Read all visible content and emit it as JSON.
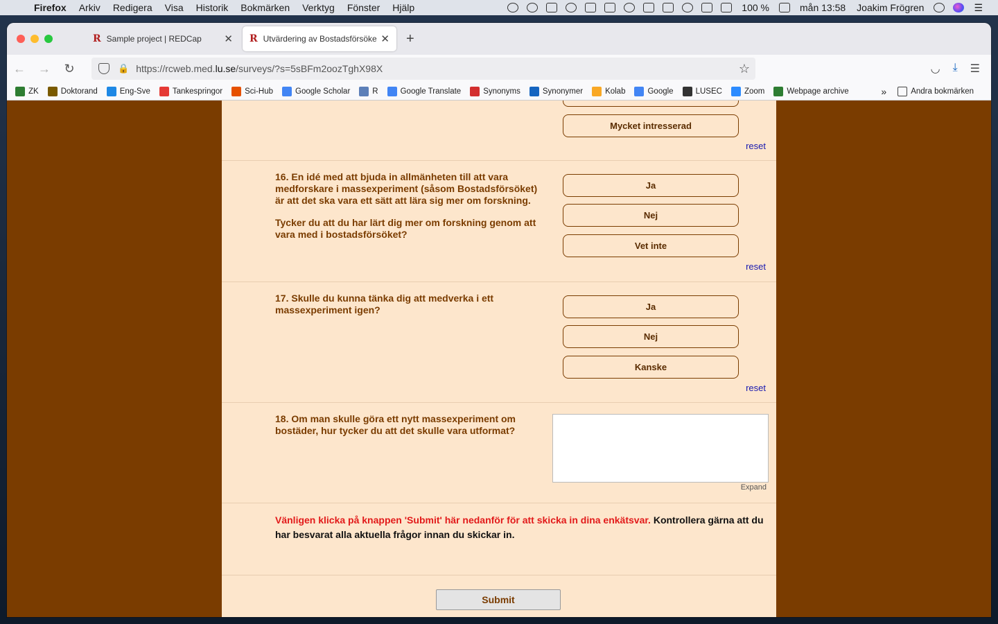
{
  "menubar": {
    "app": "Firefox",
    "items": [
      "Arkiv",
      "Redigera",
      "Visa",
      "Historik",
      "Bokmärken",
      "Verktyg",
      "Fönster",
      "Hjälp"
    ],
    "battery": "100 %",
    "datetime": "mån 13:58",
    "user": "Joakim Frögren"
  },
  "tabs": [
    {
      "title": "Sample project | REDCap"
    },
    {
      "title": "Utvärdering av Bostadsförsöket"
    }
  ],
  "urlbar": {
    "prefix": "https://rcweb.med.",
    "domain": "lu.se",
    "suffix": "/surveys/?s=5sBFm2oozTghX98X"
  },
  "bookmarks": [
    {
      "label": "ZK",
      "icon": "zk-icon",
      "color": "#2e7d32"
    },
    {
      "label": "Doktorand",
      "icon": "lu-icon",
      "color": "#7a5a00"
    },
    {
      "label": "Eng-Sve",
      "icon": "speech-bubble-icon",
      "color": "#1e88e5"
    },
    {
      "label": "Tankespringor",
      "icon": "lightning-icon",
      "color": "#e53935"
    },
    {
      "label": "Sci-Hub",
      "icon": "crow-icon",
      "color": "#e65100"
    },
    {
      "label": "Google Scholar",
      "icon": "scholar-icon",
      "color": "#4285f4"
    },
    {
      "label": "R",
      "icon": "r-icon",
      "color": "#5c7fb8"
    },
    {
      "label": "Google Translate",
      "icon": "translate-icon",
      "color": "#4285f4"
    },
    {
      "label": "Synonyms",
      "icon": "synonyms-icon",
      "color": "#d32f2f"
    },
    {
      "label": "Synonymer",
      "icon": "syn-icon",
      "color": "#1565c0"
    },
    {
      "label": "Kolab",
      "icon": "kolab-icon",
      "color": "#f9a825"
    },
    {
      "label": "Google",
      "icon": "google-icon",
      "color": "#4285f4"
    },
    {
      "label": "LUSEC",
      "icon": "lusec-icon",
      "color": "#333333"
    },
    {
      "label": "Zoom",
      "icon": "zoom-icon",
      "color": "#2d8cff"
    },
    {
      "label": "Webpage archive",
      "icon": "archive-icon",
      "color": "#2e7d32"
    }
  ],
  "bookmarks_other": "Andra bokmärken",
  "survey": {
    "q15": {
      "choices": [
        "Mycket intresserad"
      ],
      "reset": "reset"
    },
    "q16": {
      "text1": "16. En idé med att bjuda in allmänheten till att vara medforskare i massexperiment (såsom Bostadsförsöket) är att det ska vara ett sätt att lära sig mer om forskning.",
      "text2": "Tycker du att du har lärt dig mer om forskning genom att vara med i bostadsförsöket?",
      "choices": [
        "Ja",
        "Nej",
        "Vet inte"
      ],
      "reset": "reset"
    },
    "q17": {
      "text": "17. Skulle du kunna tänka dig att medverka i ett massexperiment igen?",
      "choices": [
        "Ja",
        "Nej",
        "Kanske"
      ],
      "reset": "reset"
    },
    "q18": {
      "text": "18. Om man skulle göra ett nytt massexperiment om bostäder, hur tycker du att det skulle vara utformat?",
      "value": "",
      "expand": "Expand"
    },
    "notice_red": "Vänligen klicka på knappen 'Submit' här nedanför för att skicka in dina enkätsvar.",
    "notice_black": " Kontrollera gärna att du har besvarat alla aktuella frågor innan du skickar in.",
    "submit": "Submit"
  }
}
